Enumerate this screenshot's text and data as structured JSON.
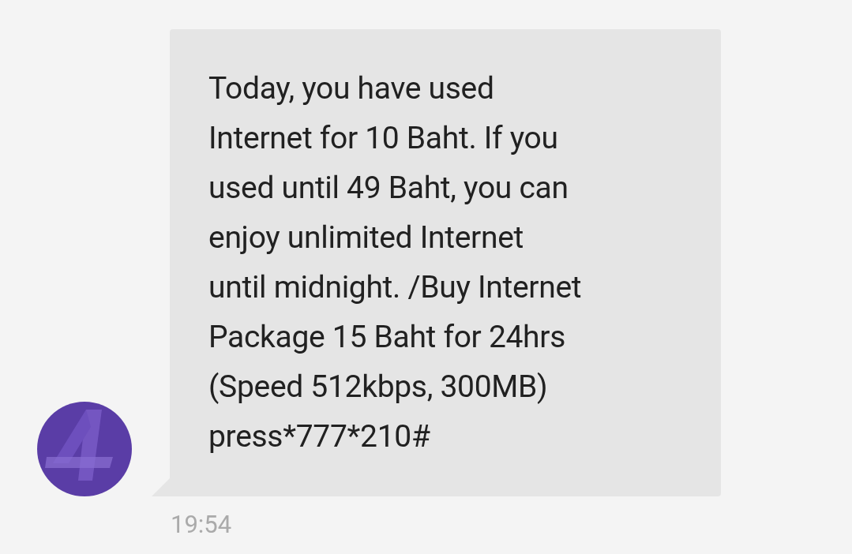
{
  "message": {
    "text": "Today, you have used\nInternet for 10 Baht. If you\nused until 49 Baht, you can\nenjoy unlimited Internet\nuntil midnight. /Buy Internet\nPackage 15 Baht for 24hrs\n(Speed 512kbps, 300MB)\npress*777*210#",
    "time": "19:54"
  }
}
